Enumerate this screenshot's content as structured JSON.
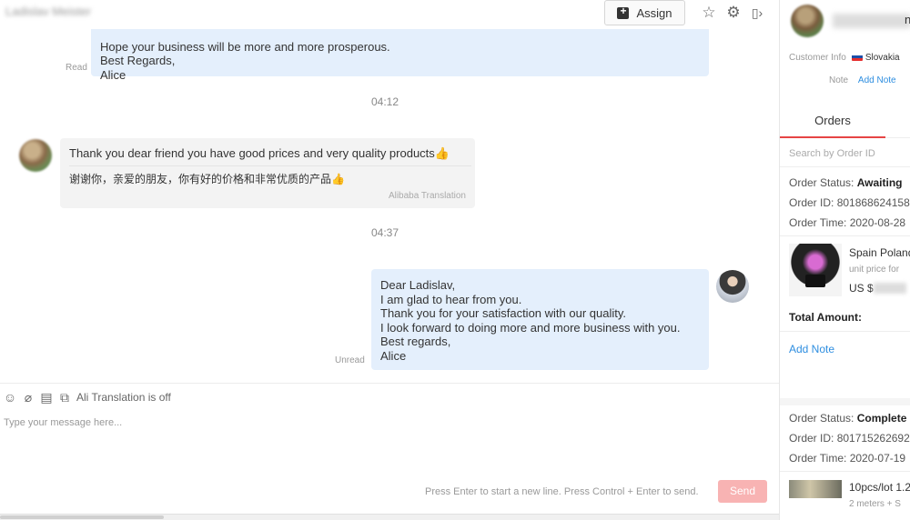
{
  "header": {
    "chat_title": "Ladislav Meister",
    "assign_label": "Assign"
  },
  "messages": {
    "out_1": {
      "lines": [
        "Hope your business will be more and more prosperous.",
        "Best Regards,",
        "Alice"
      ],
      "status": "Read"
    },
    "time_1": "04:12",
    "in_1": {
      "original": "Thank you dear friend you have good prices and very quality products",
      "translation": "谢谢你，亲爱的朋友，你有好的价格和非常优质的产品",
      "source": "Alibaba Translation"
    },
    "time_2": "04:37",
    "out_2": {
      "lines": [
        "Dear Ladislav,",
        "I am glad to hear from you.",
        "Thank you for your satisfaction with our quality.",
        "I look forward to doing more and more business with you.",
        "Best regards,",
        "Alice"
      ],
      "status": "Unread"
    }
  },
  "composer": {
    "translation_status": "Ali Translation is off",
    "placeholder": "Type your message here...",
    "hint": "Press Enter to start a new line. Press Control + Enter to send.",
    "send_label": "Send"
  },
  "customer": {
    "name_suffix": "n",
    "info_label": "Customer Info",
    "country": "Slovakia",
    "note_label": "Note",
    "add_note_label": "Add Note"
  },
  "orders_panel": {
    "tab_label": "Orders",
    "search_placeholder": "Search by Order ID",
    "orders": [
      {
        "status_label": "Order Status:",
        "status_value": "Awaiting",
        "id_label": "Order ID:",
        "id_value": "801868624158",
        "time_label": "Order Time:",
        "time_value": "2020-08-28",
        "product_title": "Spain Poland",
        "product_sub": "unit price for",
        "price_prefix": "US $",
        "total_label": "Total Amount:",
        "add_note_label": "Add Note"
      },
      {
        "status_label": "Order Status:",
        "status_value": "Complete",
        "id_label": "Order ID:",
        "id_value": "801715262692",
        "time_label": "Order Time:",
        "time_value": "2020-07-19",
        "product_title": "10pcs/lot 1.2",
        "product_sub": "2 meters + S"
      }
    ]
  },
  "colors": {
    "bubble_out": "#e4effc",
    "bubble_in": "#f3f3f3",
    "send_disabled": "#f8b3b3",
    "link": "#2e8ee0",
    "tab_active": "#e64545"
  }
}
